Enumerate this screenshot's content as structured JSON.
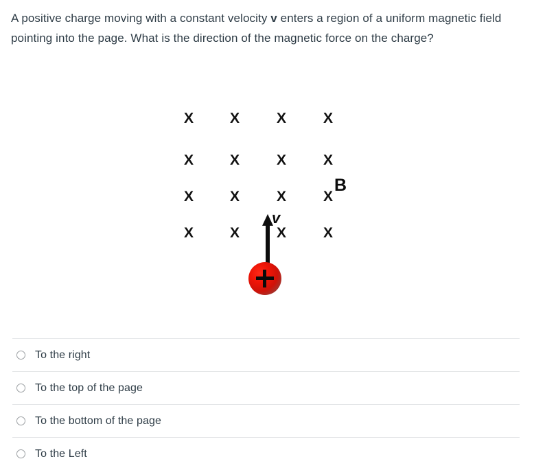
{
  "question": {
    "text_before_v": "A positive charge moving with a constant velocity ",
    "v_symbol": "v",
    "text_after_v": " enters a region of a uniform magnetic field pointing into the page. What is the direction of the magnetic force on the charge?"
  },
  "figure": {
    "field_into_page_symbol": "X",
    "field_label": "B",
    "velocity_label": "v",
    "charge_sign": "+",
    "grid": {
      "rows": 4,
      "columns": 4,
      "cells": [
        "X",
        "X",
        "X",
        "X",
        "X",
        "X",
        "X",
        "X",
        "X",
        "X",
        "X",
        "X",
        "X",
        "X",
        "X",
        "X"
      ]
    },
    "colors": {
      "charge_red": "#ef1507",
      "mark_black": "#111111"
    }
  },
  "options": [
    {
      "label": "To the right",
      "selected": false
    },
    {
      "label": "To the top of the page",
      "selected": false
    },
    {
      "label": "To the bottom of the page",
      "selected": false
    },
    {
      "label": "To the Left",
      "selected": false
    }
  ]
}
